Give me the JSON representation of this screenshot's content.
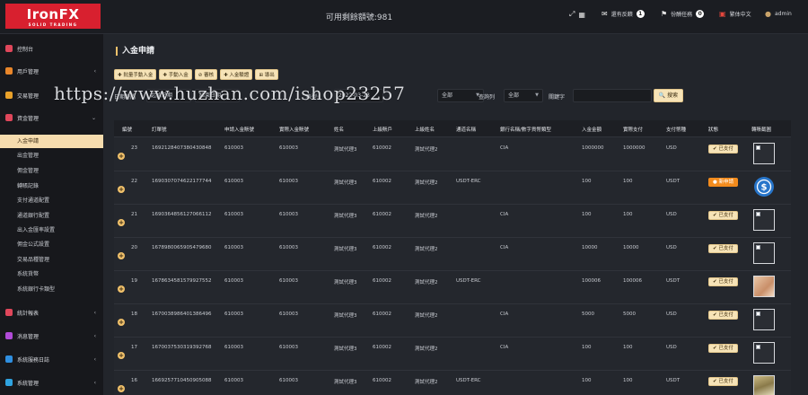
{
  "brand": {
    "name": "IronFX",
    "tagline": "SOLID TRADING"
  },
  "header": {
    "balance": "可用剩餘額號:981",
    "items": [
      {
        "label": "",
        "icon": "expand-icon"
      },
      {
        "label": "還有反饋",
        "badge": "1",
        "icon": "mail-icon"
      },
      {
        "label": "份酬任務",
        "badge": "0",
        "icon": "flag-icon"
      },
      {
        "label": "繁体中文",
        "icon": "language-icon"
      },
      {
        "label": "admin",
        "icon": "user-icon"
      }
    ]
  },
  "sidebar": {
    "groups": [
      {
        "label": "控制台",
        "color": "#e0475b"
      },
      {
        "label": "用戶管理",
        "color": "#e9862a"
      },
      {
        "label": "交易管理",
        "color": "#e9a12a"
      },
      {
        "label": "資金管理",
        "color": "#e0475b"
      },
      {
        "label": "統計報表",
        "color": "#e0475b"
      },
      {
        "label": "消息管理",
        "color": "#b14bd8"
      },
      {
        "label": "系統服務日誌",
        "color": "#2f8fe0"
      },
      {
        "label": "系統管理",
        "color": "#2fa3e0"
      }
    ],
    "sub_items": [
      "入金申請",
      "出金管理",
      "佣金管理",
      "轉賬記錄",
      "支付通道配置",
      "通道銀行配置",
      "出入金匯率設置",
      "佣金公式設置",
      "交易品種管理",
      "系統貨幣",
      "系統銀行卡類型"
    ],
    "collapse_glyph": "‹"
  },
  "page": {
    "title": "入金申請",
    "toolbar": [
      "✚ 批量手動入金",
      "✚ 手動入金",
      "⊘ 審核",
      "✚ 入金驗證",
      "⊞ 導出"
    ],
    "filters": {
      "date_label": "日期時間",
      "date_from": "起始日期",
      "date_to": "結束日期",
      "type_label": "表型:",
      "type_value": "未選",
      "status_label": "狀態",
      "status_value": "全部",
      "query_label": "查詢列",
      "query_value": "全部",
      "keyword_label": "關鍵字",
      "keyword_placeholder": "",
      "search_button": "🔍 搜索",
      "date_partial": "2022-03-23"
    }
  },
  "table": {
    "columns": [
      "編號",
      "訂單號",
      "申請入金賬號",
      "實際入金賬號",
      "姓名",
      "上級賬戶",
      "上級姓名",
      "通道名稱",
      "銀行名稱/數字貨幣類型",
      "入金金額",
      "實際支付",
      "支付幣種",
      "狀態",
      "轉賬截圖"
    ],
    "rows": [
      {
        "id": "23",
        "order": "1692128407380430848",
        "apply_acct": "610003",
        "real_acct": "610003",
        "name": "測試代理3",
        "parent_acct": "610002",
        "parent_name": "測試代理2",
        "channel": "",
        "bank": "CIA",
        "amount": "1000000",
        "paid": "1000000",
        "currency": "USD",
        "status": "已支付",
        "status_type": "paid",
        "thumb": "blank"
      },
      {
        "id": "22",
        "order": "1690307074622177744",
        "apply_acct": "610003",
        "real_acct": "610003",
        "name": "測試代理3",
        "parent_acct": "610002",
        "parent_name": "測試代理2",
        "channel": "USDT-ERC",
        "bank": "",
        "amount": "100",
        "paid": "100",
        "currency": "USDT",
        "status": "新申請",
        "status_type": "new",
        "thumb": "usdc"
      },
      {
        "id": "21",
        "order": "1690364856127066112",
        "apply_acct": "610003",
        "real_acct": "610003",
        "name": "測試代理3",
        "parent_acct": "610002",
        "parent_name": "測試代理2",
        "channel": "",
        "bank": "CIA",
        "amount": "100",
        "paid": "100",
        "currency": "USD",
        "status": "已支付",
        "status_type": "paid",
        "thumb": "blank"
      },
      {
        "id": "20",
        "order": "1678980065905479680",
        "apply_acct": "610003",
        "real_acct": "610003",
        "name": "測試代理3",
        "parent_acct": "610002",
        "parent_name": "測試代理2",
        "channel": "",
        "bank": "CIA",
        "amount": "10000",
        "paid": "10000",
        "currency": "USD",
        "status": "已支付",
        "status_type": "paid",
        "thumb": "blank"
      },
      {
        "id": "19",
        "order": "1678634581579927552",
        "apply_acct": "610003",
        "real_acct": "610003",
        "name": "測試代理3",
        "parent_acct": "610002",
        "parent_name": "測試代理2",
        "channel": "USDT-ERC",
        "bank": "",
        "amount": "100006",
        "paid": "100006",
        "currency": "USDT",
        "status": "已支付",
        "status_type": "paid",
        "thumb": "photo"
      },
      {
        "id": "18",
        "order": "1670038986401386496",
        "apply_acct": "610003",
        "real_acct": "610003",
        "name": "測試代理3",
        "parent_acct": "610002",
        "parent_name": "測試代理2",
        "channel": "",
        "bank": "CIA",
        "amount": "5000",
        "paid": "5000",
        "currency": "USD",
        "status": "已支付",
        "status_type": "paid",
        "thumb": "blank"
      },
      {
        "id": "17",
        "order": "1670037530319392768",
        "apply_acct": "610003",
        "real_acct": "610003",
        "name": "測試代理3",
        "parent_acct": "610002",
        "parent_name": "測試代理2",
        "channel": "",
        "bank": "CIA",
        "amount": "100",
        "paid": "100",
        "currency": "USD",
        "status": "已支付",
        "status_type": "paid",
        "thumb": "blank"
      },
      {
        "id": "16",
        "order": "1669257710450905088",
        "apply_acct": "610003",
        "real_acct": "610003",
        "name": "測試代理3",
        "parent_acct": "610002",
        "parent_name": "測試代理2",
        "channel": "USDT-ERC",
        "bank": "",
        "amount": "100",
        "paid": "100",
        "currency": "USDT",
        "status": "已支付",
        "status_type": "paid",
        "thumb": "receipt"
      }
    ]
  },
  "watermark": "https://www.huzhan.com/ishop23257",
  "colors": {
    "accent": "#f6e3b7",
    "brand_red": "#d8202f",
    "status_new": "#f28b1d"
  }
}
